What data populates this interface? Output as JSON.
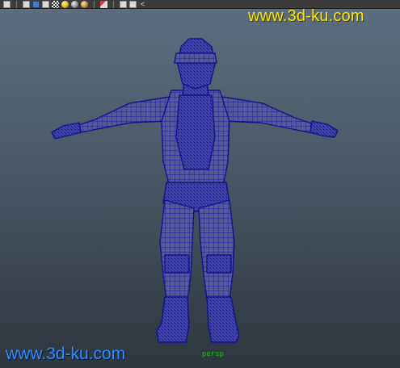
{
  "viewport": {
    "background_top": "#5d6e80",
    "background_bottom": "#2f373f",
    "camera": "persp"
  },
  "shelf": {
    "icons": [
      "cube-icon",
      "blue-cube-icon",
      "render-cube-icon",
      "checker-icon",
      "yellow-light-icon",
      "grey-light-icon",
      "orange-light-icon",
      "component-icon",
      "cube-outline-icon",
      "layered-cube-icon",
      "share-icon"
    ]
  },
  "watermarks": {
    "top": "www.3d-ku.com",
    "bottom": "www.3d-ku.com",
    "top_color": "#ffe600",
    "bottom_color": "#2f8cff"
  },
  "model": {
    "name": "character-wireframe",
    "wire_color": "#1c1ca8"
  }
}
